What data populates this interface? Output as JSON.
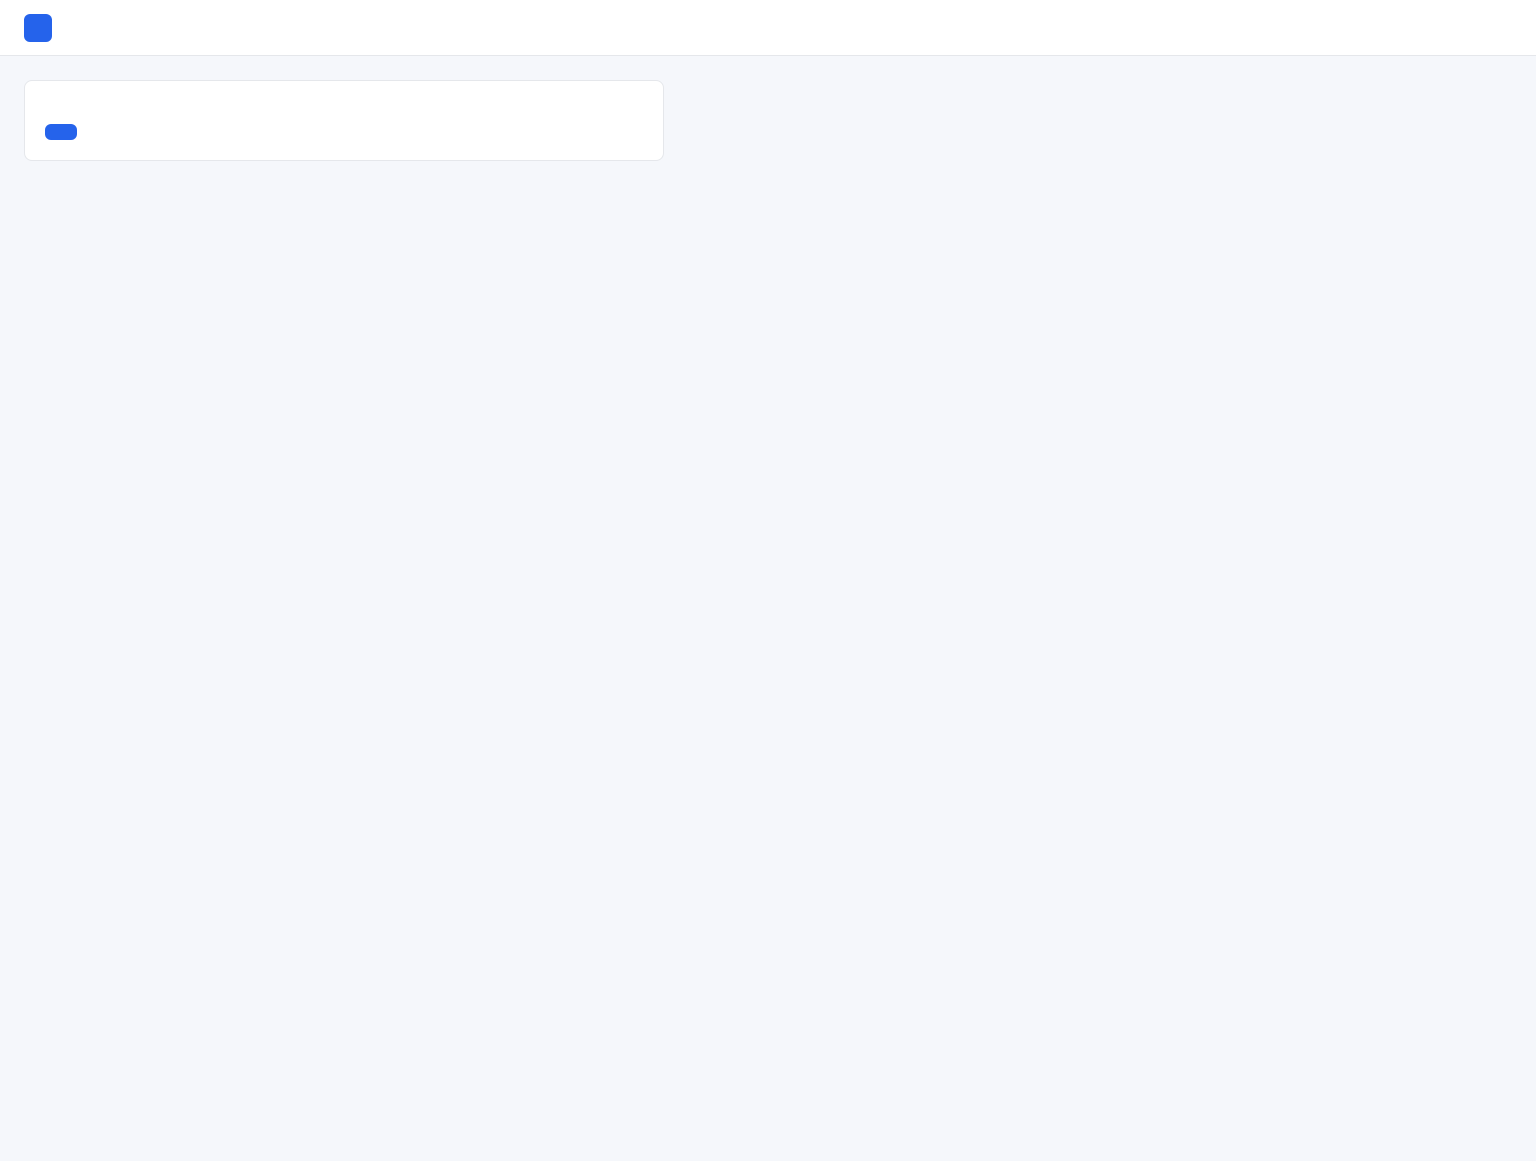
{
  "app": {
    "title": ""
  },
  "content": {
    "heading": "",
    "message": "",
    "button_label": ""
  }
}
